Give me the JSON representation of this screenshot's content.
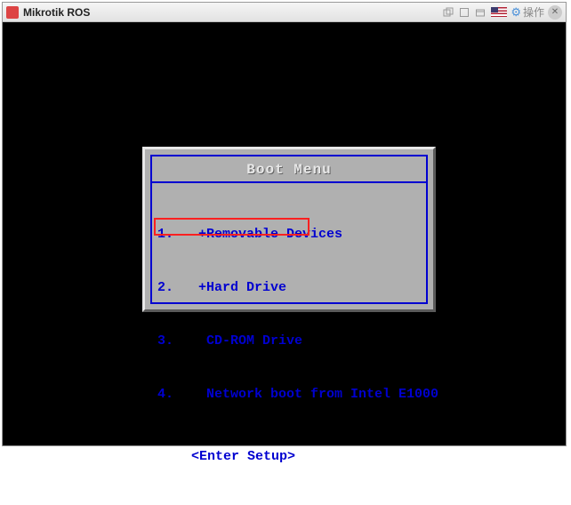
{
  "window": {
    "title": "Mikrotik ROS",
    "operations_label": "操作"
  },
  "boot_menu": {
    "title": "Boot Menu",
    "items": [
      {
        "num": "1.",
        "label": "+Removable Devices"
      },
      {
        "num": "2.",
        "label": "+Hard Drive"
      },
      {
        "num": "3.",
        "label": " CD-ROM Drive"
      },
      {
        "num": "4.",
        "label": " Network boot from Intel E1000"
      }
    ],
    "highlighted_index": 2,
    "enter_setup": "<Enter Setup>"
  }
}
